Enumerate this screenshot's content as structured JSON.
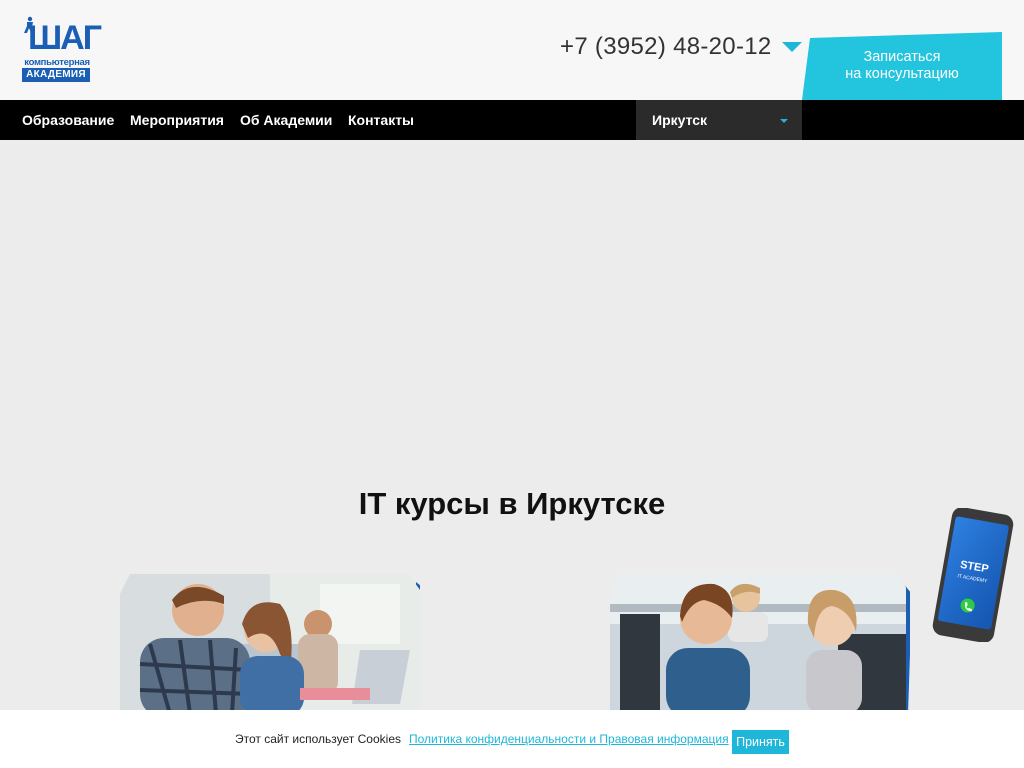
{
  "header": {
    "logo": {
      "word": "ШАГ",
      "line1": "компьютерная",
      "line2": "АКАДЕМИЯ"
    },
    "phone": "+7 (3952) 48-20-12",
    "cta_line1": "Записаться",
    "cta_line2": "на консультацию"
  },
  "nav": {
    "items": [
      "Образование",
      "Мероприятия",
      "Об Академии",
      "Контакты"
    ],
    "city": "Иркутск"
  },
  "main": {
    "title": "IT курсы в Иркутске",
    "cards": [
      {
        "image": "adults-studying-photo"
      },
      {
        "image": "kids-at-computers-photo"
      }
    ]
  },
  "widget": {
    "label": "STEP IT Academy",
    "icon": "phone-call-icon"
  },
  "cookie": {
    "text": "Этот сайт использует Cookies",
    "link": "Политика конфиденциальности и Правовая информация",
    "accept": "Принять"
  },
  "colors": {
    "accent": "#1eb6d9",
    "brand": "#1a5fb4",
    "nav_bg": "#000000"
  }
}
